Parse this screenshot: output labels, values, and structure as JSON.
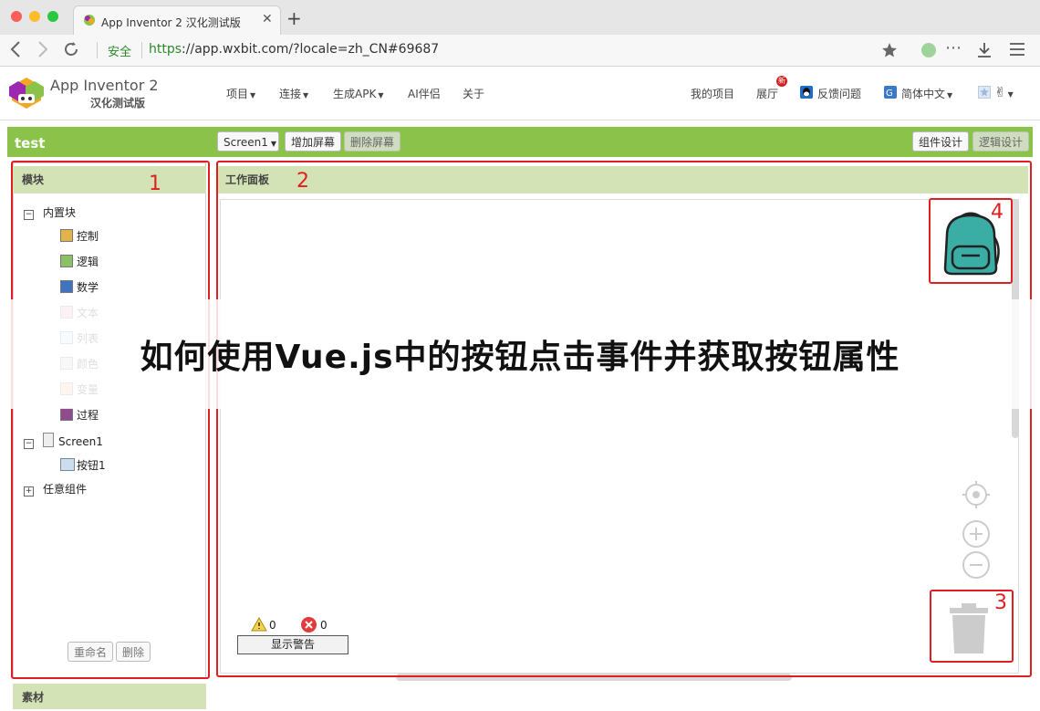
{
  "browser": {
    "tab_title": "App Inventor 2 汉化测试版",
    "tab_close": "✕",
    "new_tab": "+",
    "secure_label": "安全",
    "url_scheme": "https",
    "url_rest": "://app.wxbit.com/?locale=zh_CN#69687"
  },
  "header": {
    "app_title": "App Inventor 2",
    "app_subtitle": "汉化测试版",
    "menus": [
      "项目",
      "连接",
      "生成APK",
      "AI伴侣",
      "关于"
    ],
    "right_menu": {
      "my_projects": "我的项目",
      "gallery": "展厅",
      "gallery_badge": "新",
      "feedback": "反馈问题",
      "language": "简体中文"
    }
  },
  "toolbar": {
    "project_name": "test",
    "screen_select": "Screen1",
    "add_screen": "增加屏幕",
    "remove_screen": "删除屏幕",
    "designer": "组件设计",
    "blocks": "逻辑设计"
  },
  "blocks_panel": {
    "header": "模块",
    "builtin_label": "内置块",
    "builtin": [
      {
        "label": "控制",
        "color": "#e2b34b"
      },
      {
        "label": "逻辑",
        "color": "#8cc065"
      },
      {
        "label": "数学",
        "color": "#3f72c0"
      },
      {
        "label": "文本",
        "color": "#e8aac4"
      },
      {
        "label": "列表",
        "color": "#bfe0f2"
      },
      {
        "label": "颜色",
        "color": "#cccccc"
      },
      {
        "label": "变量",
        "color": "#f4b896"
      },
      {
        "label": "过程",
        "color": "#8e4c8e"
      }
    ],
    "screen_label": "Screen1",
    "button_label": "按钮1",
    "any_component": "任意组件",
    "rename": "重命名",
    "delete": "删除",
    "media_header": "素材"
  },
  "workspace": {
    "header": "工作面板",
    "warning_count": "0",
    "error_count": "0",
    "show_warnings": "显示警告"
  },
  "annotations": [
    "1",
    "2",
    "3",
    "4"
  ],
  "overlay": {
    "title": "如何使用Vue.js中的按钮点击事件并获取按钮属性"
  }
}
